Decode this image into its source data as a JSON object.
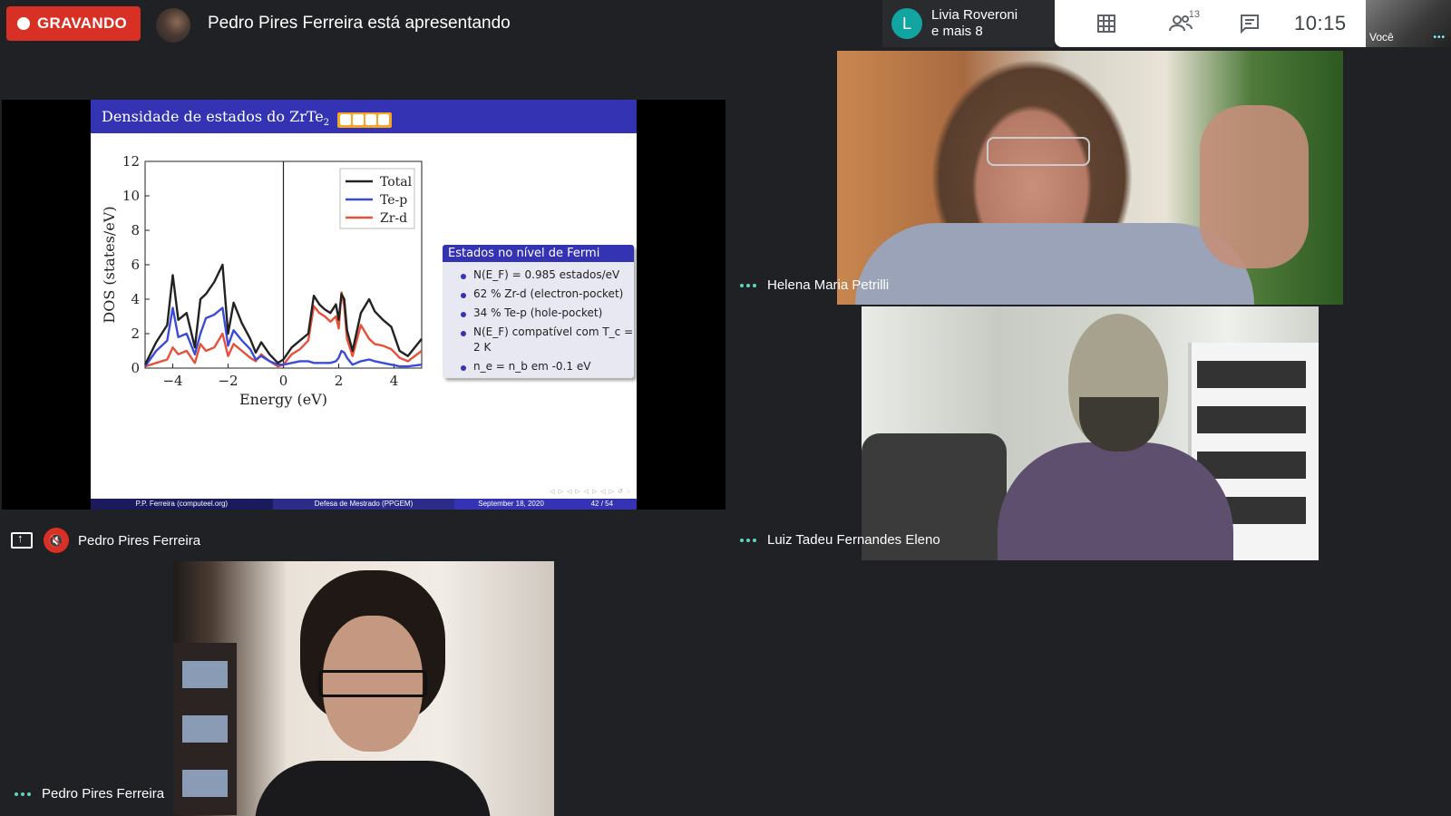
{
  "top_bar": {
    "recording_label": "GRAVANDO",
    "presenting_text": "Pedro Pires Ferreira está apresentando",
    "pinned": {
      "avatar_letter": "L",
      "name": "Livia Roveroni",
      "more": "e mais 8"
    },
    "participants_count": "13",
    "clock": "10:15",
    "self_label": "Você"
  },
  "slide": {
    "title": "Densidade de estados do ZrTe",
    "title_sub": "2",
    "footer": {
      "author": "P.P. Ferreira  (computeel.org)",
      "event": "Defesa de Mestrado (PPGEM)",
      "date": "September 18, 2020",
      "page": "42 / 54"
    },
    "fermi_box": {
      "title": "Estados no nível de Fermi",
      "items": [
        "N(E_F) = 0.985 estados/eV",
        "62 % Zr-d (electron-pocket)",
        "34 % Te-p (hole-pocket)",
        "N(E_F) compatível com T_c = 2 K",
        "n_e = n_b em -0.1 eV"
      ]
    }
  },
  "chart_data": {
    "type": "line",
    "xlabel": "Energy (eV)",
    "ylabel": "DOS (states/eV)",
    "xlim": [
      -5,
      5
    ],
    "ylim": [
      0,
      12
    ],
    "xticks": [
      "−4",
      "−2",
      "0",
      "2",
      "4"
    ],
    "yticks": [
      "0",
      "2",
      "4",
      "6",
      "8",
      "10",
      "12"
    ],
    "legend_position": "top-right",
    "x": [
      -5,
      -4.6,
      -4.2,
      -4.0,
      -3.8,
      -3.5,
      -3.2,
      -3.0,
      -2.8,
      -2.5,
      -2.2,
      -2.0,
      -1.8,
      -1.5,
      -1.2,
      -1.0,
      -0.8,
      -0.5,
      -0.2,
      0,
      0.3,
      0.6,
      0.9,
      1.1,
      1.3,
      1.5,
      1.7,
      1.9,
      2.0,
      2.1,
      2.2,
      2.3,
      2.5,
      2.8,
      3.1,
      3.3,
      3.6,
      3.9,
      4.2,
      4.5,
      5.0
    ],
    "series": [
      {
        "name": "Total",
        "color": "#222222",
        "values": [
          0.2,
          1.5,
          2.5,
          5.4,
          2.8,
          3.2,
          1.2,
          4.0,
          4.3,
          5.0,
          6.0,
          2.0,
          3.8,
          2.6,
          1.7,
          0.9,
          1.5,
          0.8,
          0.3,
          0.5,
          1.2,
          1.6,
          2.0,
          4.2,
          3.7,
          3.4,
          3.2,
          3.7,
          2.8,
          4.3,
          4.0,
          2.2,
          1.0,
          3.2,
          4.0,
          3.3,
          2.8,
          2.4,
          1.0,
          0.7,
          1.7
        ]
      },
      {
        "name": "Te-p",
        "color": "#3b4bd9",
        "values": [
          0.1,
          1.0,
          1.6,
          3.5,
          1.8,
          2.0,
          0.8,
          2.0,
          2.9,
          3.1,
          3.5,
          1.3,
          2.2,
          1.6,
          1.1,
          0.5,
          0.7,
          0.4,
          0.2,
          0.2,
          0.3,
          0.4,
          0.4,
          0.3,
          0.3,
          0.3,
          0.3,
          0.4,
          0.6,
          1.0,
          0.9,
          0.6,
          0.2,
          0.4,
          0.5,
          0.4,
          0.3,
          0.2,
          0.1,
          0.1,
          0.2
        ]
      },
      {
        "name": "Zr-d",
        "color": "#e8503a",
        "values": [
          0.1,
          0.3,
          0.5,
          1.2,
          0.8,
          1.0,
          0.3,
          1.4,
          1.0,
          1.2,
          2.0,
          0.7,
          1.4,
          1.0,
          0.6,
          0.4,
          0.8,
          0.4,
          0.1,
          0.2,
          0.8,
          1.1,
          1.6,
          3.6,
          3.2,
          3.0,
          2.7,
          3.0,
          2.3,
          4.4,
          3.6,
          1.7,
          0.7,
          2.5,
          1.7,
          1.4,
          1.3,
          1.1,
          0.6,
          0.4,
          1.0
        ]
      }
    ]
  },
  "tiles": {
    "presenter_name": "Pedro Pires Ferreira",
    "helena_name": "Helena Maria Petrilli",
    "luiz_name": "Luiz Tadeu Fernandes Eleno",
    "pedro_name": "Pedro Pires Ferreira"
  },
  "icons": {
    "recording": "recording-dot-icon",
    "grid": "grid-layout-icon",
    "people": "people-icon",
    "chat": "chat-icon",
    "more": "more-options-icon",
    "present": "present-screen-icon",
    "mic_off": "mic-off-icon"
  },
  "colors": {
    "background": "#202124",
    "recording_red": "#d93025",
    "accent_teal": "#12a4a1",
    "slide_blue": "#3333b3"
  }
}
